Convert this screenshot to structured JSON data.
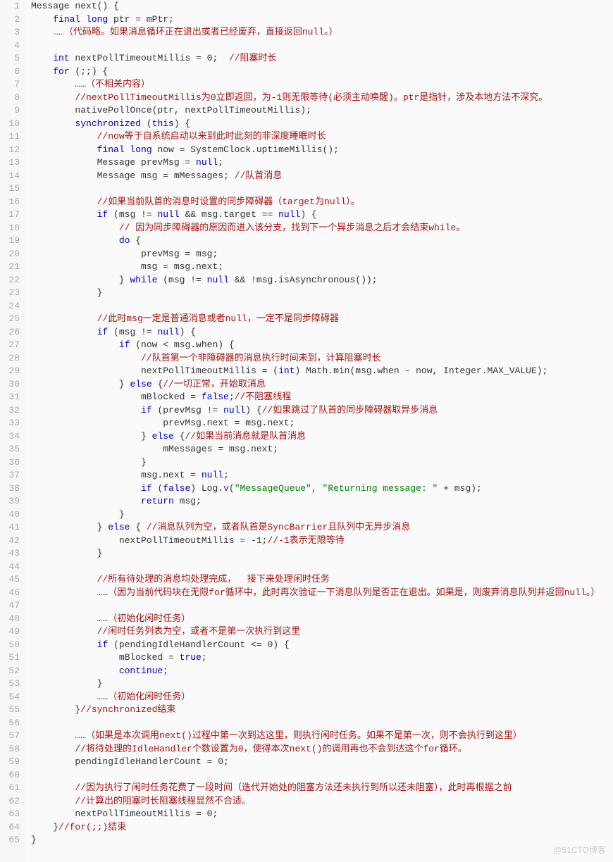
{
  "lineCount": 65,
  "watermark": "@51CTO博客",
  "lines": [
    [
      [
        "",
        "Message next() {"
      ]
    ],
    [
      [
        "",
        "    "
      ],
      [
        "kw",
        "final long"
      ],
      [
        "",
        " ptr = mPtr;"
      ]
    ],
    [
      [
        "",
        "    ……"
      ],
      [
        "cm",
        "（代码略。如果消息循环正在退出或者已经废弃，直接返回null。）"
      ]
    ],
    [
      [
        "",
        ""
      ]
    ],
    [
      [
        "",
        "    "
      ],
      [
        "kw",
        "int"
      ],
      [
        "",
        " nextPollTimeoutMillis = "
      ],
      [
        "",
        "0"
      ],
      [
        "",
        ";  "
      ],
      [
        "cm",
        "//阻塞时长"
      ]
    ],
    [
      [
        "",
        "    "
      ],
      [
        "kw",
        "for"
      ],
      [
        "",
        " (;;) {"
      ]
    ],
    [
      [
        "",
        "        ……"
      ],
      [
        "cm",
        "（不相关内容）"
      ]
    ],
    [
      [
        "",
        "        "
      ],
      [
        "cm",
        "//nextPollTimeoutMillis为0立即返回，为-1则无限等待(必须主动唤醒)。ptr是指针，涉及本地方法不深究。"
      ]
    ],
    [
      [
        "",
        "        nativePollOnce(ptr, nextPollTimeoutMillis);"
      ]
    ],
    [
      [
        "",
        "        "
      ],
      [
        "kw",
        "synchronized"
      ],
      [
        "",
        " ("
      ],
      [
        "kw",
        "this"
      ],
      [
        "",
        ") {"
      ]
    ],
    [
      [
        "",
        "            "
      ],
      [
        "cm",
        "//now等于自系统启动以来到此时此刻的非深度睡眠时长"
      ]
    ],
    [
      [
        "",
        "            "
      ],
      [
        "kw",
        "final long"
      ],
      [
        "",
        " now = SystemClock.uptimeMillis();"
      ]
    ],
    [
      [
        "",
        "            Message prevMsg = "
      ],
      [
        "kw",
        "null"
      ],
      [
        "",
        ";"
      ]
    ],
    [
      [
        "",
        "            Message msg = mMessages; "
      ],
      [
        "cm",
        "//队首消息"
      ]
    ],
    [
      [
        "",
        ""
      ]
    ],
    [
      [
        "",
        "            "
      ],
      [
        "cm",
        "//如果当前队首的消息时设置的同步障碍器（target为null）。"
      ]
    ],
    [
      [
        "",
        "            "
      ],
      [
        "kw",
        "if"
      ],
      [
        "",
        " (msg != "
      ],
      [
        "kw",
        "null"
      ],
      [
        "",
        " && msg.target == "
      ],
      [
        "kw",
        "null"
      ],
      [
        "",
        ") {"
      ]
    ],
    [
      [
        "",
        "                "
      ],
      [
        "cm",
        "// 因为同步障碍器的原因而进入该分支，找到下一个异步消息之后才会结束while。"
      ]
    ],
    [
      [
        "",
        "                "
      ],
      [
        "kw",
        "do"
      ],
      [
        "",
        " {"
      ]
    ],
    [
      [
        "",
        "                    prevMsg = msg;"
      ]
    ],
    [
      [
        "",
        "                    msg = msg.next;"
      ]
    ],
    [
      [
        "",
        "                } "
      ],
      [
        "kw",
        "while"
      ],
      [
        "",
        " (msg != "
      ],
      [
        "kw",
        "null"
      ],
      [
        "",
        " && !msg.isAsynchronous());"
      ]
    ],
    [
      [
        "",
        "            }"
      ]
    ],
    [
      [
        "",
        ""
      ]
    ],
    [
      [
        "",
        "            "
      ],
      [
        "cm",
        "//此时msg一定是普通消息或者null，一定不是同步障碍器"
      ]
    ],
    [
      [
        "",
        "            "
      ],
      [
        "kw",
        "if"
      ],
      [
        "",
        " (msg != "
      ],
      [
        "kw",
        "null"
      ],
      [
        "",
        ") {"
      ]
    ],
    [
      [
        "",
        "                "
      ],
      [
        "kw",
        "if"
      ],
      [
        "",
        " (now < msg.when) {"
      ]
    ],
    [
      [
        "",
        "                    "
      ],
      [
        "cm",
        "//队首第一个非障碍器的消息执行时间未到，计算阻塞时长"
      ]
    ],
    [
      [
        "",
        "                    nextPollTimeoutMillis = ("
      ],
      [
        "kw",
        "int"
      ],
      [
        "",
        ") Math.min(msg.when - now, Integer.MAX_VALUE);"
      ]
    ],
    [
      [
        "",
        "                } "
      ],
      [
        "kw",
        "else"
      ],
      [
        "",
        " {"
      ],
      [
        "cm",
        "//一切正常，开始取消息"
      ]
    ],
    [
      [
        "",
        "                    mBlocked = "
      ],
      [
        "kw",
        "false"
      ],
      [
        "",
        ";"
      ],
      [
        "cm",
        "//不阻塞线程"
      ]
    ],
    [
      [
        "",
        "                    "
      ],
      [
        "kw",
        "if"
      ],
      [
        "",
        " (prevMsg != "
      ],
      [
        "kw",
        "null"
      ],
      [
        "",
        ") {"
      ],
      [
        "cm",
        "//如果跳过了队首的同步障碍器取异步消息"
      ]
    ],
    [
      [
        "",
        "                        prevMsg.next = msg.next;"
      ]
    ],
    [
      [
        "",
        "                    } "
      ],
      [
        "kw",
        "else"
      ],
      [
        "",
        " {"
      ],
      [
        "cm",
        "//如果当前消息就是队首消息"
      ]
    ],
    [
      [
        "",
        "                        mMessages = msg.next;"
      ]
    ],
    [
      [
        "",
        "                    }"
      ]
    ],
    [
      [
        "",
        "                    msg.next = "
      ],
      [
        "kw",
        "null"
      ],
      [
        "",
        ";"
      ]
    ],
    [
      [
        "",
        "                    "
      ],
      [
        "kw",
        "if"
      ],
      [
        "",
        " ("
      ],
      [
        "kw",
        "false"
      ],
      [
        "",
        ") Log.v("
      ],
      [
        "str",
        "\"MessageQueue\""
      ],
      [
        "",
        ", "
      ],
      [
        "str",
        "\"Returning message: \""
      ],
      [
        "",
        " + msg);"
      ]
    ],
    [
      [
        "",
        "                    "
      ],
      [
        "kw",
        "return"
      ],
      [
        "",
        " msg;"
      ]
    ],
    [
      [
        "",
        "                }"
      ]
    ],
    [
      [
        "",
        "            } "
      ],
      [
        "kw",
        "else"
      ],
      [
        "",
        " { "
      ],
      [
        "cm",
        "//消息队列为空，或者队首是SyncBarrier且队列中无异步消息"
      ]
    ],
    [
      [
        "",
        "                nextPollTimeoutMillis = -1;"
      ],
      [
        "cm",
        "//-1表示无限等待"
      ]
    ],
    [
      [
        "",
        "            }"
      ]
    ],
    [
      [
        "",
        ""
      ]
    ],
    [
      [
        "",
        "            "
      ],
      [
        "cm",
        "//所有待处理的消息均处理完成，  接下来处理闲时任务"
      ]
    ],
    [
      [
        "",
        "            ……"
      ],
      [
        "cm",
        "（因为当前代码块在无限for循环中，此时再次验证一下消息队列是否正在退出。如果是，则废弃消息队列并返回null。）"
      ]
    ],
    [
      [
        "",
        ""
      ]
    ],
    [
      [
        "",
        "            ……"
      ],
      [
        "cm",
        "（初始化闲时任务）"
      ]
    ],
    [
      [
        "",
        "            "
      ],
      [
        "cm",
        "//闲时任务列表为空，或者不是第一次执行到这里"
      ]
    ],
    [
      [
        "",
        "            "
      ],
      [
        "kw",
        "if"
      ],
      [
        "",
        " (pendingIdleHandlerCount <= 0) {"
      ]
    ],
    [
      [
        "",
        "                mBlocked = "
      ],
      [
        "kw",
        "true"
      ],
      [
        "",
        ";"
      ]
    ],
    [
      [
        "",
        "                "
      ],
      [
        "kw",
        "continue"
      ],
      [
        "",
        ";"
      ]
    ],
    [
      [
        "",
        "            }"
      ]
    ],
    [
      [
        "",
        "            ……"
      ],
      [
        "cm",
        "（初始化闲时任务）"
      ]
    ],
    [
      [
        "",
        "        }"
      ],
      [
        "cm",
        "//synchronized结束"
      ]
    ],
    [
      [
        "",
        ""
      ]
    ],
    [
      [
        "",
        "        ……"
      ],
      [
        "cm",
        "（如果是本次调用next()过程中第一次到达这里，则执行闲时任务。如果不是第一次，则不会执行到这里）"
      ]
    ],
    [
      [
        "",
        "        "
      ],
      [
        "cm",
        "//将待处理的IdleHandler个数设置为0，使得本次next()的调用再也不会到达这个for循环。"
      ]
    ],
    [
      [
        "",
        "        pendingIdleHandlerCount = 0;"
      ]
    ],
    [
      [
        "",
        ""
      ]
    ],
    [
      [
        "",
        "        "
      ],
      [
        "cm",
        "//因为执行了闲时任务花费了一段时间（迭代开始处的阻塞方法还未执行到所以还未阻塞），此时再根据之前"
      ]
    ],
    [
      [
        "",
        "        "
      ],
      [
        "cm",
        "//计算出的阻塞时长阻塞线程显然不合适。"
      ]
    ],
    [
      [
        "",
        "        nextPollTimeoutMillis = 0;"
      ]
    ],
    [
      [
        "",
        "    }"
      ],
      [
        "cm",
        "//for(;;)结束"
      ]
    ],
    [
      [
        "",
        "}"
      ]
    ]
  ]
}
